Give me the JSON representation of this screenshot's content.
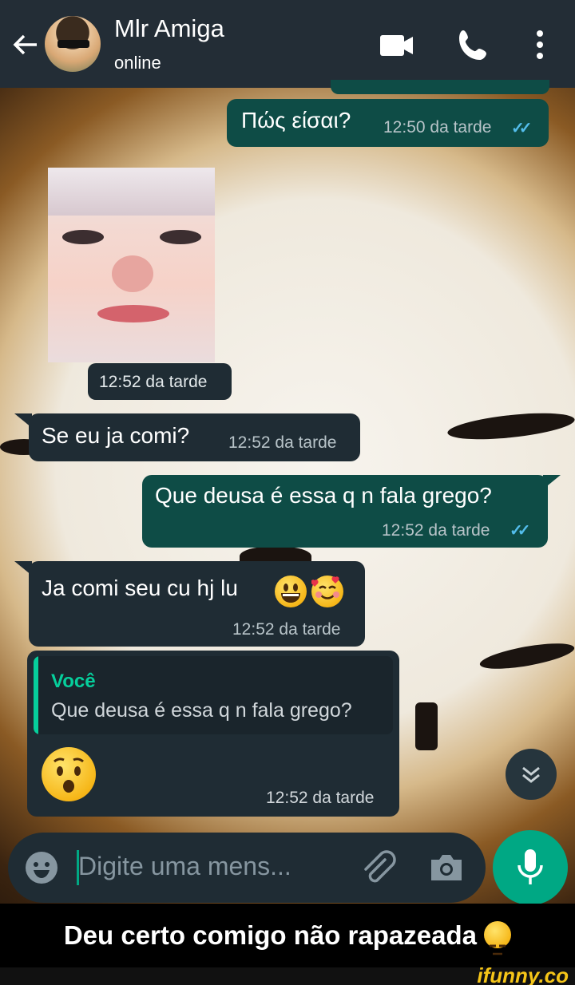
{
  "header": {
    "contact_name": "Mlr Amiga",
    "status": "online",
    "back_glyph": "🡐",
    "icons": [
      "back-arrow-icon",
      "video-call-icon",
      "phone-icon",
      "more-vert-icon"
    ]
  },
  "messages": [
    {
      "direction": "out",
      "text": "Πώς είσαι?",
      "time": "12:50 da tarde",
      "ticks": "✓✓"
    },
    {
      "direction": "in",
      "type": "image",
      "time": "12:52 da tarde"
    },
    {
      "direction": "in",
      "text": "Se eu ja comi?",
      "time": "12:52 da tarde"
    },
    {
      "direction": "out",
      "text": "Que deusa é essa q n fala grego?",
      "time": "12:52 da tarde",
      "ticks": "✓✓"
    },
    {
      "direction": "in",
      "text": "Ja comi seu cu hj lu",
      "emoji": [
        "grinning-face",
        "smiling-face-with-hearts"
      ],
      "time": "12:52 da tarde"
    },
    {
      "direction": "in",
      "reply_to": {
        "author": "Você",
        "text": "Que deusa é essa q n fala grego?"
      },
      "emoji": "hushed-face",
      "time": "12:52 da tarde"
    }
  ],
  "input": {
    "placeholder": "Digite uma mens...",
    "icons": [
      "emoji-icon",
      "attach-icon",
      "camera-icon",
      "mic-icon"
    ]
  },
  "caption": "Deu certo comigo não rapazeada",
  "watermark": "ifunny.co",
  "colors": {
    "header": "#232d36",
    "outgoing_bubble": "#0e4c46",
    "incoming_bubble": "#1f2c34",
    "accent": "#00a884",
    "read_ticks": "#53bdeb"
  }
}
